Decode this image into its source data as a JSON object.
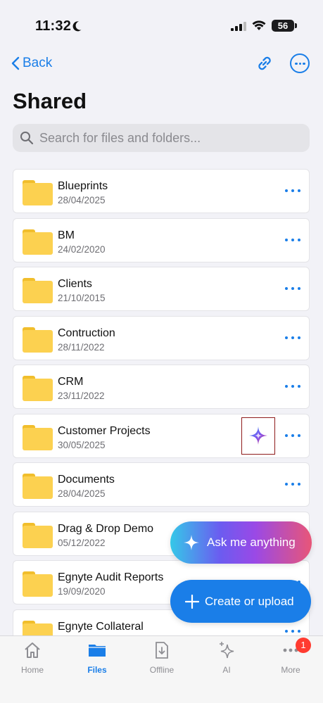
{
  "status_bar": {
    "time": "11:32",
    "battery": "56"
  },
  "nav": {
    "back_label": "Back",
    "link_icon": "link-icon",
    "more_icon": "ellipsis-circle-icon"
  },
  "page": {
    "title": "Shared"
  },
  "search": {
    "placeholder": "Search for files and folders..."
  },
  "folders": [
    {
      "name": "Blueprints",
      "date": "28/04/2025"
    },
    {
      "name": "BM",
      "date": "24/02/2020"
    },
    {
      "name": "Clients",
      "date": "21/10/2015"
    },
    {
      "name": "Contruction",
      "date": "28/11/2022"
    },
    {
      "name": "CRM",
      "date": "23/11/2022"
    },
    {
      "name": "Customer Projects",
      "date": "30/05/2025"
    },
    {
      "name": "Documents",
      "date": "28/04/2025"
    },
    {
      "name": "Drag & Drop Demo",
      "date": "05/12/2022"
    },
    {
      "name": "Egnyte Audit Reports",
      "date": "19/09/2020"
    },
    {
      "name": "Egnyte Collateral",
      "date": ""
    }
  ],
  "fab": {
    "ask_label": "Ask me anything",
    "create_label": "Create or upload"
  },
  "tabbar": {
    "tabs": [
      {
        "label": "Home",
        "icon": "house-icon"
      },
      {
        "label": "Files",
        "icon": "folder-icon"
      },
      {
        "label": "Offline",
        "icon": "download-doc-icon"
      },
      {
        "label": "AI",
        "icon": "sparkles-icon"
      },
      {
        "label": "More",
        "icon": "ellipsis-icon"
      }
    ],
    "active": "Files",
    "more_badge": "1"
  },
  "colors": {
    "accent": "#1a7ee8",
    "folder": "#fcd150",
    "badge": "#ff3b30"
  }
}
